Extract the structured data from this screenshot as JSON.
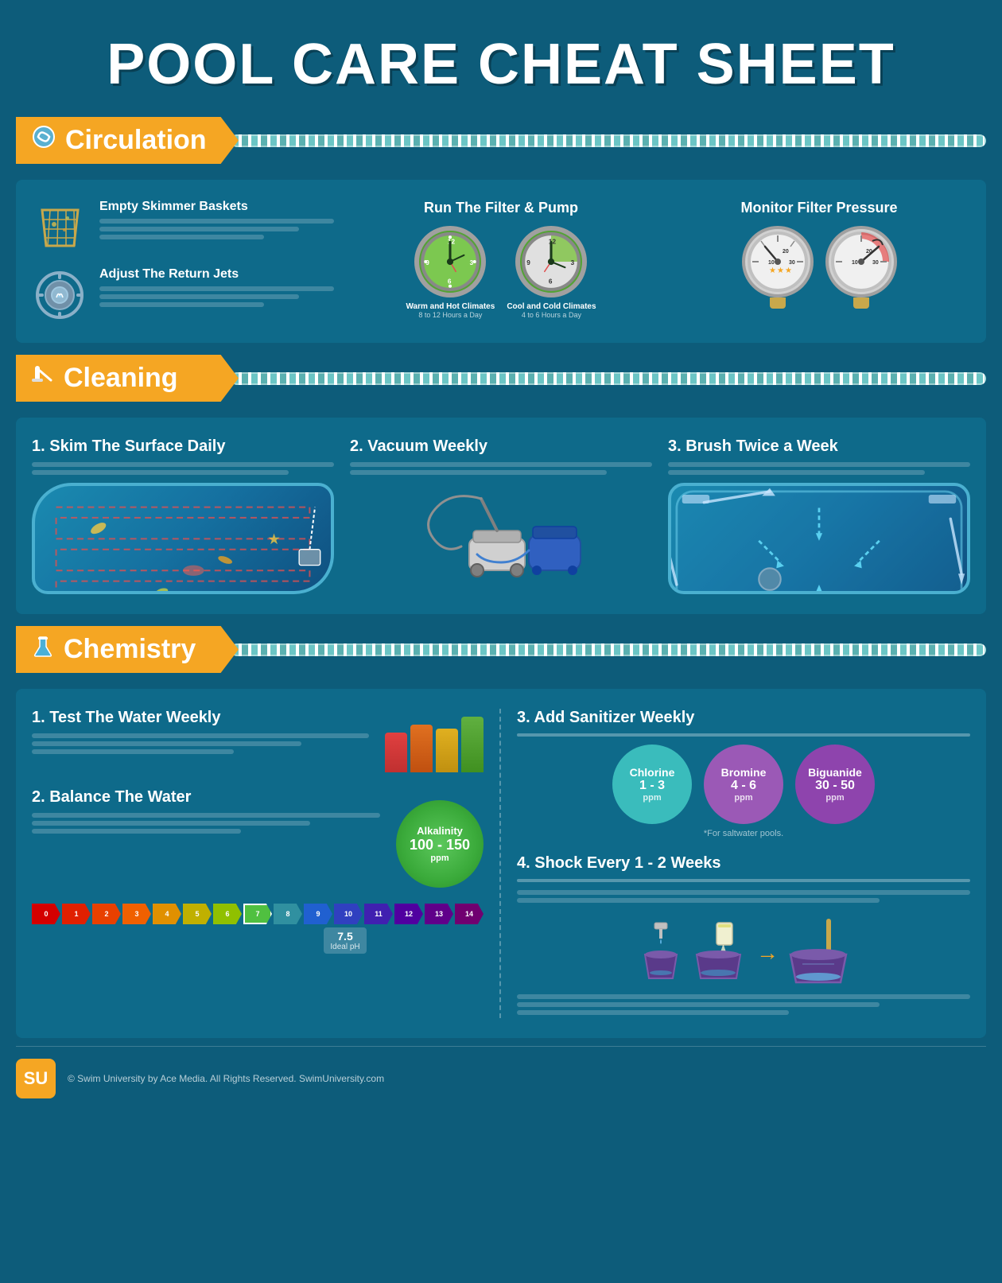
{
  "page": {
    "title": "POOL CARE CHEAT SHEET",
    "bg_color": "#0d5c7a"
  },
  "sections": {
    "circulation": {
      "label": "Circulation",
      "icon": "🪣",
      "items": [
        {
          "label": "Empty Skimmer Baskets",
          "lines": [
            "long",
            "medium",
            "short"
          ]
        },
        {
          "label": "Adjust The Return Jets",
          "lines": [
            "long",
            "medium",
            "short"
          ]
        }
      ],
      "filter": {
        "title": "Run The Filter & Pump",
        "clock1_label": "Warm and Hot Climates",
        "clock1_sub": "8 to 12 Hours a Day",
        "clock2_label": "Cool and Cold Climates",
        "clock2_sub": "4 to 6 Hours a Day"
      },
      "pressure": {
        "title": "Monitor Filter Pressure"
      }
    },
    "cleaning": {
      "label": "Cleaning",
      "icon": "🪣",
      "item1": {
        "title": "1. Skim The Surface Daily",
        "lines": [
          "long",
          "medium"
        ]
      },
      "item2": {
        "title": "2. Vacuum Weekly",
        "lines": [
          "long",
          "medium"
        ]
      },
      "item3": {
        "title": "3. Brush Twice a Week",
        "lines": [
          "long",
          "medium"
        ]
      }
    },
    "chemistry": {
      "label": "Chemistry",
      "icon": "🧪",
      "test": {
        "title": "1. Test The Water Weekly",
        "lines": [
          "long",
          "medium",
          "short"
        ]
      },
      "balance": {
        "title": "2. Balance The Water",
        "lines": [
          "long",
          "medium",
          "short"
        ],
        "alkalinity_label": "Alkalinity",
        "alkalinity_value": "100 - 150",
        "alkalinity_unit": "ppm"
      },
      "ph_scale": {
        "label": "7.5",
        "sublabel": "Ideal pH",
        "values": [
          "0",
          "1",
          "2",
          "3",
          "4",
          "5",
          "6",
          "7",
          "8",
          "9",
          "10",
          "11",
          "12",
          "13",
          "14"
        ],
        "colors": [
          "#d40000",
          "#e02000",
          "#e84000",
          "#f06000",
          "#e09000",
          "#c0b000",
          "#90c000",
          "#50c040",
          "#40b860",
          "#3090a0",
          "#2060d0",
          "#3040c0",
          "#4020b0",
          "#5000a0",
          "#60008a"
        ]
      },
      "sanitizer": {
        "title": "3. Add Sanitizer Weekly",
        "note": "*For saltwater pools.",
        "items": [
          {
            "name": "Chlorine",
            "value": "1 - 3",
            "unit": "ppm",
            "color": "#3abcbc"
          },
          {
            "name": "Bromine",
            "value": "4 - 6",
            "unit": "ppm",
            "color": "#9b59b6"
          },
          {
            "name": "Biguanide",
            "value": "30 - 50",
            "unit": "ppm",
            "color": "#8e44ad"
          }
        ]
      },
      "shock": {
        "title": "4. Shock Every 1 - 2 Weeks",
        "lines": [
          "long",
          "medium",
          "short"
        ]
      }
    }
  },
  "footer": {
    "logo": "SU",
    "text": "© Swim University by Ace Media. All Rights Reserved. SwimUniversity.com"
  }
}
